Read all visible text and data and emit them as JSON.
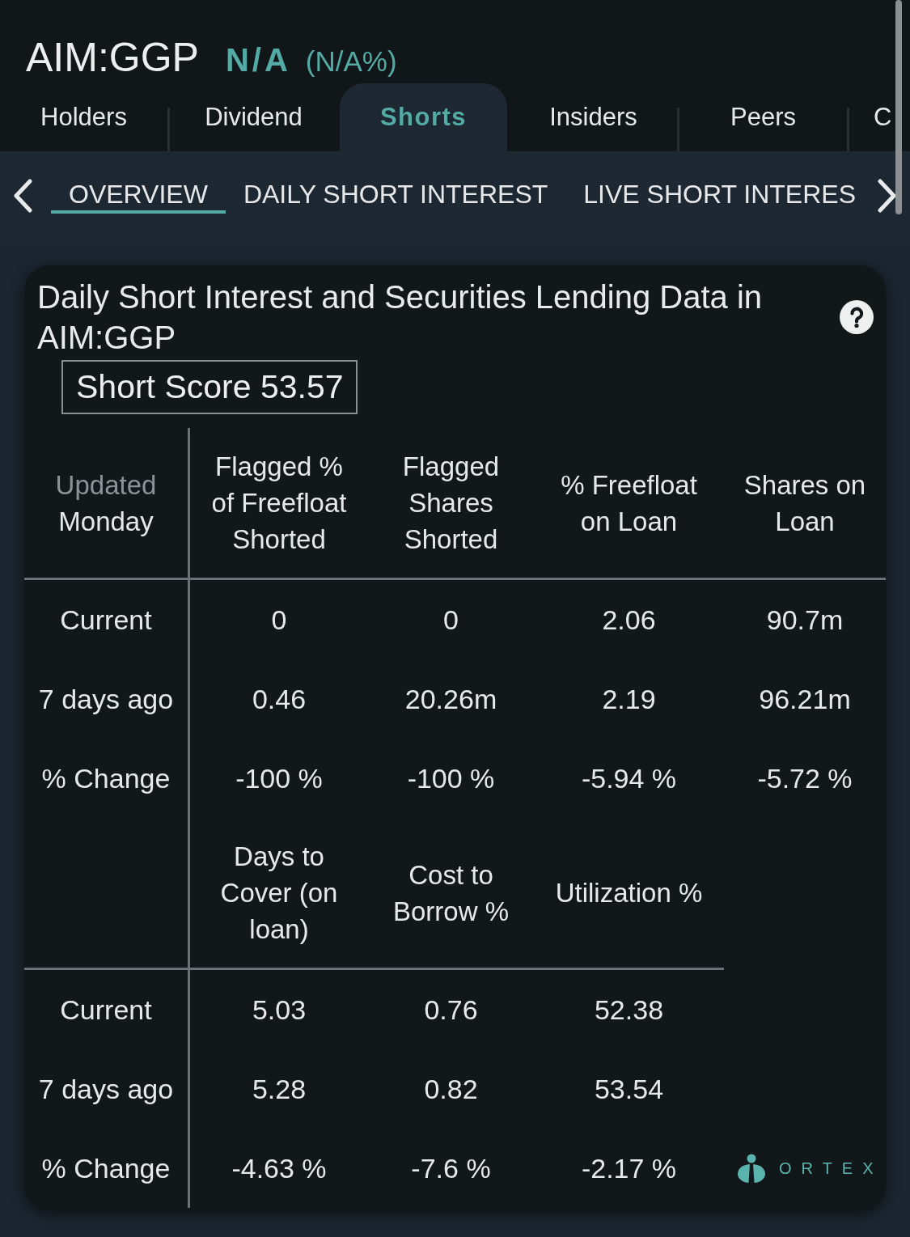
{
  "header": {
    "symbol": "AIM:GGP",
    "price": "N/A",
    "change": "(N/A%)"
  },
  "tabs": [
    {
      "label": "Holders",
      "selected": false
    },
    {
      "label": "Dividend",
      "selected": false
    },
    {
      "label": "Shorts",
      "selected": true
    },
    {
      "label": "Insiders",
      "selected": false
    },
    {
      "label": "Peers",
      "selected": false
    },
    {
      "label": "C",
      "selected": false
    }
  ],
  "subtabs": [
    {
      "label": "OVERVIEW",
      "selected": true
    },
    {
      "label": "DAILY SHORT INTEREST",
      "selected": false
    },
    {
      "label": "LIVE SHORT INTERES",
      "selected": false
    }
  ],
  "card": {
    "title": "Daily Short Interest and Securities Lending Data in AIM:GGP",
    "short_score": "Short Score 53.57",
    "tables": [
      {
        "corner": {
          "note": "Updated",
          "label": "Monday"
        },
        "columns": [
          "Flagged % of Freefloat Shorted",
          "Flagged Shares Shorted",
          "% Freefloat on Loan",
          "Shares on Loan"
        ],
        "rows": [
          {
            "label": "Current",
            "values": [
              "0",
              "0",
              "2.06",
              "90.7m"
            ]
          },
          {
            "label": "7 days ago",
            "values": [
              "0.46",
              "20.26m",
              "2.19",
              "96.21m"
            ]
          },
          {
            "label": "% Change",
            "values": [
              "-100 %",
              "-100 %",
              "-5.94 %",
              "-5.72 %"
            ]
          }
        ]
      },
      {
        "columns": [
          "Days to Cover (on loan)",
          "Cost to Borrow %",
          "Utilization %"
        ],
        "rows": [
          {
            "label": "Current",
            "values": [
              "5.03",
              "0.76",
              "52.38"
            ]
          },
          {
            "label": "7 days ago",
            "values": [
              "5.28",
              "0.82",
              "53.54"
            ]
          },
          {
            "label": "% Change",
            "values": [
              "-4.63 %",
              "-7.6 %",
              "-2.17 %"
            ]
          }
        ]
      }
    ],
    "brand": "ORTEX"
  }
}
